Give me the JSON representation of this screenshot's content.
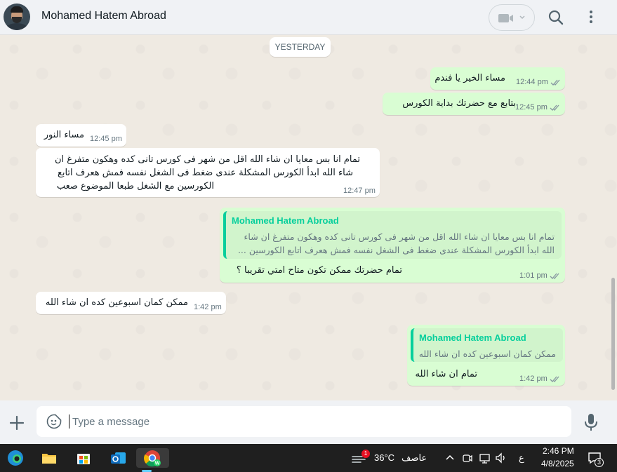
{
  "header": {
    "contact_name": "Mohamed Hatem Abroad"
  },
  "chat": {
    "date_separator": "YESTERDAY",
    "messages": [
      {
        "direction": "out",
        "text": "مساء الخير يا فندم",
        "time": "12:44 pm"
      },
      {
        "direction": "out",
        "text": "بتابع مع حضرتك بداية الكورس",
        "time": "12:45 pm"
      },
      {
        "direction": "in",
        "text": "مساء النور",
        "time": "12:45 pm"
      },
      {
        "direction": "in",
        "lines": [
          "تمام انا بس معايا ان شاء الله اقل من شهر فى كورس تانى كده وهكون متفرغ ان",
          "شاء الله ابدأ الكورس المشكلة عندى ضغط فى الشغل نفسه فمش هعرف اتابع",
          "الكورسين مع الشغل طبعا الموضوع صعب"
        ],
        "time": "12:47 pm"
      },
      {
        "direction": "out",
        "quote_name": "Mohamed Hatem Abroad",
        "quote_lines": [
          "تمام انا بس معايا ان شاء الله اقل من شهر فى كورس تانى كده وهكون متفرغ ان شاء",
          "الله ابدأ الكورس المشكلة عندى ضغط فى الشغل نفسه فمش هعرف اتابع الكورسين ..."
        ],
        "text": "تمام حضرتك ممكن تكون متاح امتي تقريبا ؟",
        "time": "1:01 pm"
      },
      {
        "direction": "in",
        "text": "ممكن كمان اسبوعين كده ان شاء الله",
        "time": "1:42 pm"
      },
      {
        "direction": "out",
        "quote_name": "Mohamed Hatem Abroad",
        "quote_lines": [
          "ممكن كمان اسبوعين كده ان شاء الله"
        ],
        "text": "تمام ان شاء الله",
        "time": "1:42 pm"
      }
    ]
  },
  "composer": {
    "placeholder": "Type a message"
  },
  "taskbar": {
    "weather_badge": "1",
    "temperature": "36°C",
    "weather_desc": "عاصف",
    "lang": "ع",
    "time": "2:46 PM",
    "date": "4/8/2025",
    "notif_count": "3"
  },
  "colors": {
    "outgoing_bubble": "#d9fdd3",
    "incoming_bubble": "#ffffff",
    "quote_accent": "#06cf9c",
    "chat_bg": "#efeae2"
  }
}
